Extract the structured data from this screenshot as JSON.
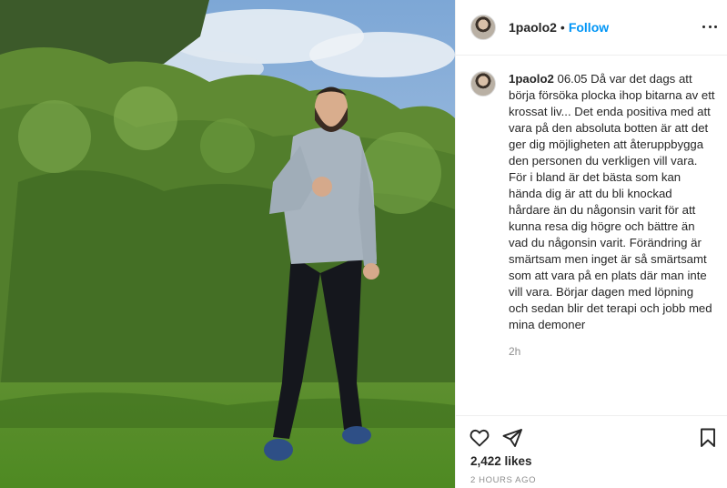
{
  "post": {
    "username": "1paolo2",
    "separator": "•",
    "follow_label": "Follow",
    "more_icon": "more-options-icon",
    "caption": "06.05 Då var det dags att börja försöka plocka ihop bitarna av ett krossat liv... Det enda positiva med att vara på den absoluta botten är att det ger dig möjligheten att återuppbygga den personen du verkligen vill vara. För i bland är det bästa som kan hända dig är att du bli knockad hårdare än du någonsin varit för att kunna resa dig högre och bättre än vad du någonsin varit. Förändring är smärtsam men inget är så smärtsamt som att vara på en plats där man inte vill vara. Börjar dagen med löpning och sedan blir det terapi och jobb med mina demoner",
    "caption_time": "2h",
    "likes": "2,422 likes",
    "posted_ago": "2 HOURS AGO"
  },
  "icons": {
    "like": "heart-icon",
    "share": "paper-plane-icon",
    "save": "bookmark-icon"
  },
  "colors": {
    "follow": "#0095f6",
    "text": "#262626",
    "muted": "#8e8e8e",
    "border": "#efefef"
  }
}
